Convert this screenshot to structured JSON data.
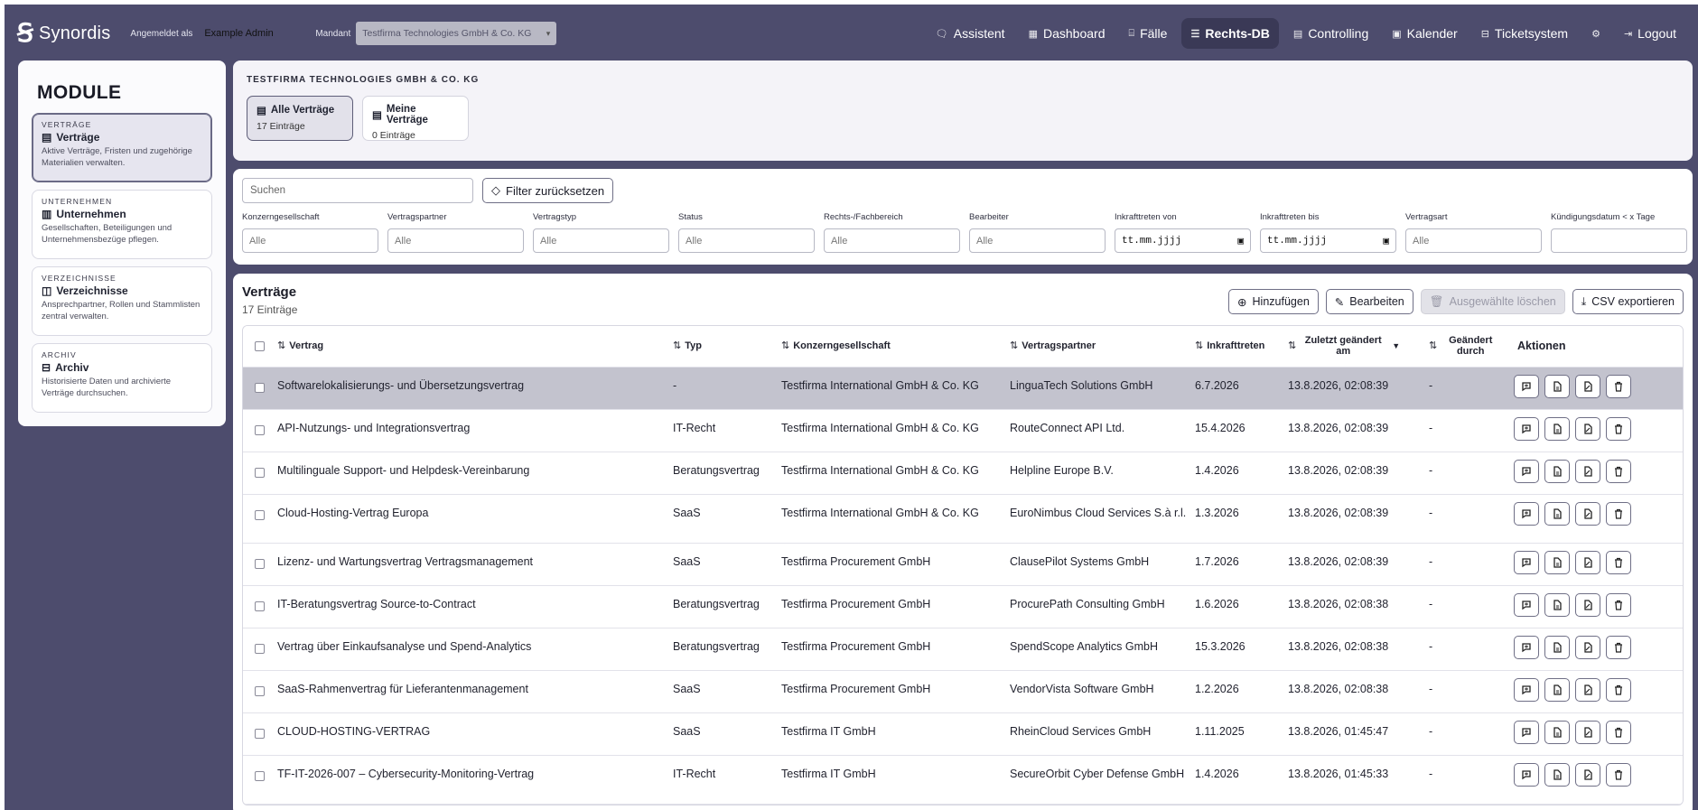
{
  "topbar": {
    "logo_text": "Synordis",
    "logged_in_label": "Angemeldet als",
    "user_value": "Example Admin",
    "mandant_label": "Mandant",
    "mandant_value": "Testfirma Technologies GmbH & Co. KG",
    "nav": [
      {
        "label": "Assistent",
        "icon": "chat-icon"
      },
      {
        "label": "Dashboard",
        "icon": "grid-icon"
      },
      {
        "label": "Fälle",
        "icon": "briefcase-icon"
      },
      {
        "label": "Rechts-DB",
        "icon": "database-icon"
      },
      {
        "label": "Controlling",
        "icon": "document-icon"
      },
      {
        "label": "Kalender",
        "icon": "calendar-icon"
      },
      {
        "label": "Ticketsystem",
        "icon": "ticket-icon"
      },
      {
        "label": "",
        "icon": "gear-icon"
      },
      {
        "label": "Logout",
        "icon": "logout-icon"
      }
    ]
  },
  "sidebar": {
    "title": "MODULE",
    "modules": [
      {
        "category": "VERTRÄGE",
        "title": "Verträge",
        "desc": "Aktive Verträge, Fristen und zugehörige Materialien verwalten."
      },
      {
        "category": "UNTERNEHMEN",
        "title": "Unternehmen",
        "desc": "Gesellschaften, Beteiligungen und Unternehmensbezüge pflegen."
      },
      {
        "category": "VERZEICHNISSE",
        "title": "Verzeichnisse",
        "desc": "Ansprechpartner, Rollen und Stammlisten zentral verwalten."
      },
      {
        "category": "ARCHIV",
        "title": "Archiv",
        "desc": "Historisierte Daten und archivierte Verträge durchsuchen."
      }
    ]
  },
  "header": {
    "company": "TESTFIRMA TECHNOLOGIES GMBH & CO. KG",
    "tabs": [
      {
        "title": "Alle Verträge",
        "count": "17 Einträge"
      },
      {
        "title": "Meine Verträge",
        "count": "0 Einträge"
      }
    ]
  },
  "filters": {
    "search_placeholder": "Suchen",
    "reset_label": "Filter zurücksetzen",
    "fields": [
      {
        "label": "Konzerngesellschaft",
        "value": "Alle"
      },
      {
        "label": "Vertragspartner",
        "value": "Alle"
      },
      {
        "label": "Vertragstyp",
        "value": "Alle"
      },
      {
        "label": "Status",
        "value": "Alle"
      },
      {
        "label": "Rechts-/Fachbereich",
        "value": "Alle"
      },
      {
        "label": "Bearbeiter",
        "value": "Alle"
      },
      {
        "label": "Inkrafttreten von",
        "value": "tt.mm.jjjj"
      },
      {
        "label": "Inkrafttreten bis",
        "value": "tt.mm.jjjj"
      },
      {
        "label": "Vertragsart",
        "value": "Alle"
      },
      {
        "label": "Kündigungsdatum < x Tage",
        "value": ""
      }
    ]
  },
  "table": {
    "title": "Verträge",
    "subtitle": "17 Einträge",
    "buttons": {
      "add": "Hinzufügen",
      "edit": "Bearbeiten",
      "delete": "Ausgewählte löschen",
      "export": "CSV exportieren"
    },
    "columns": [
      "Vertrag",
      "Typ",
      "Konzerngesellschaft",
      "Vertragspartner",
      "Inkrafttreten",
      "Zuletzt geändert am",
      "Geändert durch",
      "Aktionen"
    ],
    "rows": [
      [
        "Softwarelokalisierungs- und Übersetzungsvertrag",
        "-",
        "Testfirma International GmbH & Co. KG",
        "LinguaTech Solutions GmbH",
        "6.7.2026",
        "13.8.2026, 02:08:39",
        "-"
      ],
      [
        "API-Nutzungs- und Integrationsvertrag",
        "IT-Recht",
        "Testfirma International GmbH & Co. KG",
        "RouteConnect API Ltd.",
        "15.4.2026",
        "13.8.2026, 02:08:39",
        "-"
      ],
      [
        "Multilinguale Support- und Helpdesk-Vereinbarung",
        "Beratungsvertrag",
        "Testfirma International GmbH & Co. KG",
        "Helpline Europe B.V.",
        "1.4.2026",
        "13.8.2026, 02:08:39",
        "-"
      ],
      [
        "Cloud-Hosting-Vertrag Europa",
        "SaaS",
        "Testfirma International GmbH & Co. KG",
        "EuroNimbus Cloud Services S.à r.l.",
        "1.3.2026",
        "13.8.2026, 02:08:39",
        "-"
      ],
      [
        "Lizenz- und Wartungsvertrag Vertragsmanagement",
        "SaaS",
        "Testfirma Procurement GmbH",
        "ClausePilot Systems GmbH",
        "1.7.2026",
        "13.8.2026, 02:08:39",
        "-"
      ],
      [
        "IT-Beratungsvertrag Source-to-Contract",
        "Beratungsvertrag",
        "Testfirma Procurement GmbH",
        "ProcurePath Consulting GmbH",
        "1.6.2026",
        "13.8.2026, 02:08:38",
        "-"
      ],
      [
        "Vertrag über Einkaufsanalyse und Spend-Analytics",
        "Beratungsvertrag",
        "Testfirma Procurement GmbH",
        "SpendScope Analytics GmbH",
        "15.3.2026",
        "13.8.2026, 02:08:38",
        "-"
      ],
      [
        "SaaS-Rahmenvertrag für Lieferantenmanagement",
        "SaaS",
        "Testfirma Procurement GmbH",
        "VendorVista Software GmbH",
        "1.2.2026",
        "13.8.2026, 02:08:38",
        "-"
      ],
      [
        "CLOUD-HOSTING-VERTRAG",
        "SaaS",
        "Testfirma IT GmbH",
        "RheinCloud Services GmbH",
        "1.11.2025",
        "13.8.2026, 01:45:47",
        "-"
      ],
      [
        "TF-IT-2026-007 – Cybersecurity-Monitoring-Vertrag",
        "IT-Recht",
        "Testfirma IT GmbH",
        "SecureOrbit Cyber Defense GmbH",
        "1.4.2026",
        "13.8.2026, 01:45:33",
        "-"
      ]
    ]
  }
}
